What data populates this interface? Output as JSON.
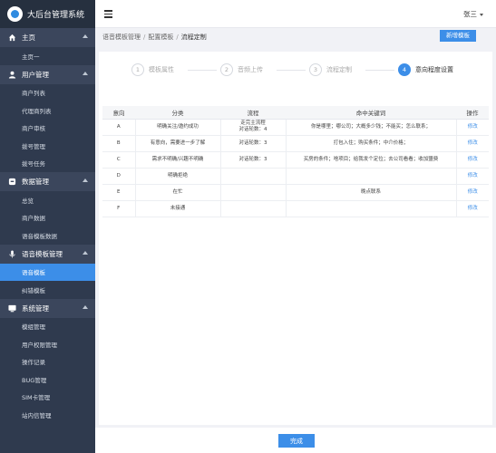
{
  "app": {
    "title": "大后台管理系统"
  },
  "header": {
    "user": "张三"
  },
  "breadcrumb": [
    "语音模板管理",
    "配置模板",
    "流程定制"
  ],
  "actions": {
    "add_template": "新增模板",
    "done": "完成"
  },
  "sidebar": {
    "groups": [
      {
        "title": "主页",
        "icon": "home-icon",
        "items": [
          "主页一"
        ]
      },
      {
        "title": "用户管理",
        "icon": "user-icon",
        "items": [
          "商户列表",
          "代理商列表",
          "商户审核",
          "拨号管理",
          "拨号任务"
        ]
      },
      {
        "title": "数据管理",
        "icon": "data-icon",
        "items": [
          "总览",
          "商户数据",
          "语音模板数据"
        ]
      },
      {
        "title": "语音模板管理",
        "icon": "microphone-icon",
        "items": [
          "语音模板",
          "纠错模板"
        ]
      },
      {
        "title": "系统管理",
        "icon": "system-icon",
        "items": [
          "模组管理",
          "用户权限管理",
          "操作记录",
          "BUG管理",
          "SIM卡管理",
          "站内信管理"
        ]
      }
    ],
    "active_item": "语音模板"
  },
  "steps": [
    {
      "num": "1",
      "label": "模板属性",
      "active": false
    },
    {
      "num": "2",
      "label": "音频上传",
      "active": false
    },
    {
      "num": "3",
      "label": "流程定制",
      "active": false
    },
    {
      "num": "4",
      "label": "意向程度设置",
      "active": true
    }
  ],
  "table": {
    "headers": [
      "意向",
      "分类",
      "流程",
      "命中关键词",
      "操作"
    ],
    "rows": [
      {
        "intent": "A",
        "category": "明确关注/邀约成功",
        "flow": "走完主流程\n对话轮数：4",
        "keywords": "你是哪里；哪公司；大概多少钱；不能买；怎么联系；",
        "action": "修改"
      },
      {
        "intent": "B",
        "category": "有意向，需要进一步了解",
        "flow": "对话轮数：3",
        "keywords": "打包入住；购买条件；中介价格；",
        "action": "修改"
      },
      {
        "intent": "C",
        "category": "需求不明确/兴趣不明确",
        "flow": "对话轮数：3",
        "keywords": "买房的条件；啥项目；给我发个定位；去公司看看；收加盟费",
        "action": "修改"
      },
      {
        "intent": "D",
        "category": "明确拒绝",
        "flow": "",
        "keywords": "",
        "action": "修改"
      },
      {
        "intent": "E",
        "category": "在忙",
        "flow": "",
        "keywords": "晚点联系",
        "action": "修改"
      },
      {
        "intent": "F",
        "category": "未接通",
        "flow": "",
        "keywords": "",
        "action": "修改"
      }
    ]
  },
  "colors": {
    "sidebar_bg": "#2f3a4e",
    "accent": "#3c8ee8"
  }
}
